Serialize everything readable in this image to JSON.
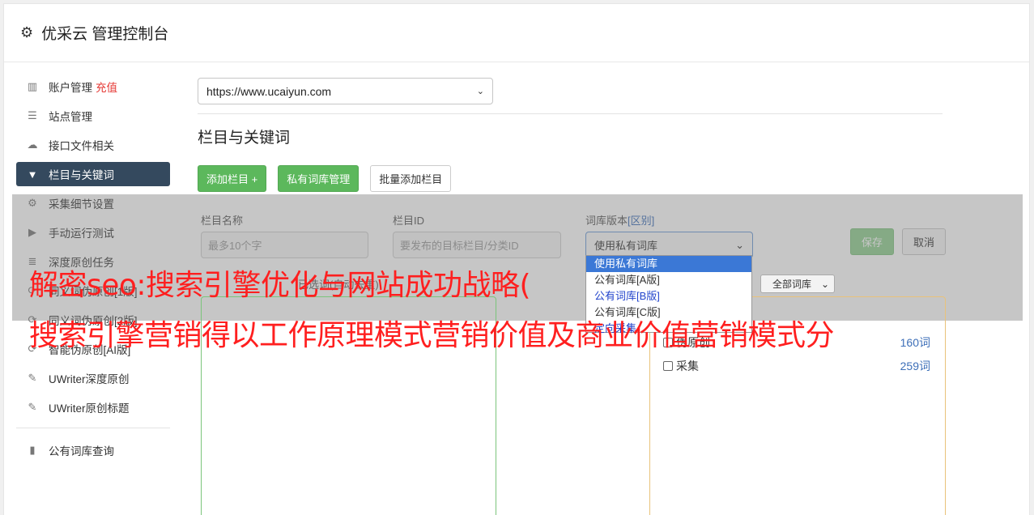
{
  "header": {
    "title": "优采云 管理控制台",
    "icon": "gear-icon"
  },
  "sidebar": {
    "items": [
      {
        "label": "账户管理",
        "extra": "充值",
        "icon": "bar-chart-icon"
      },
      {
        "label": "站点管理",
        "icon": "server-icon"
      },
      {
        "label": "接口文件相关",
        "icon": "cloud-upload-icon"
      },
      {
        "label": "栏目与关键词",
        "icon": "filter-icon",
        "active": true
      },
      {
        "label": "采集细节设置",
        "icon": "cogs-icon"
      },
      {
        "label": "手动运行测试",
        "icon": "play-circle-icon"
      },
      {
        "label": "深度原创任务",
        "icon": "list-icon"
      },
      {
        "label": "同义词伪原创[1版]",
        "icon": "refresh-icon"
      },
      {
        "label": "同义词伪原创[2版]",
        "icon": "refresh-icon"
      },
      {
        "label": "智能伪原创[AI版]",
        "icon": "refresh-icon"
      },
      {
        "label": "UWriter深度原创",
        "icon": "edit-icon"
      },
      {
        "label": "UWriter原创标题",
        "icon": "edit-icon"
      }
    ],
    "bottom_items": [
      {
        "label": "公有词库查询",
        "icon": "book-icon"
      }
    ]
  },
  "main": {
    "site_select": {
      "value": "https://www.ucaiyun.com"
    },
    "section_title": "栏目与关键词",
    "buttons": {
      "add_column": "添加栏目 +",
      "private_lib": "私有词库管理",
      "batch_add": "批量添加栏目"
    },
    "form": {
      "name_label": "栏目名称",
      "name_placeholder": "最多10个字",
      "id_label": "栏目ID",
      "id_placeholder": "要发布的目标栏目/分类ID",
      "lib_label": "词库版本",
      "lib_label_link": "[区别]",
      "lib_value": "使用私有词库",
      "save": "保存",
      "cancel": "取消"
    },
    "dropdown_options": [
      "使用私有词库",
      "公有词库[A版]",
      "公有词库[B版]",
      "公有词库[C版]",
      "定向采集"
    ],
    "sub_hint": "已选词(自动去重)",
    "lib_filter": "全部词库",
    "right_panel": [
      {
        "label": "伪原创",
        "count": "160词"
      },
      {
        "label": "采集",
        "count": "259词"
      }
    ]
  },
  "banner": {
    "line1": "解密seo:搜索引擎优化与网站成功战略(",
    "line2": "搜索引擎营销得以工作原理模式营销价值及商业价值营销模式分"
  }
}
